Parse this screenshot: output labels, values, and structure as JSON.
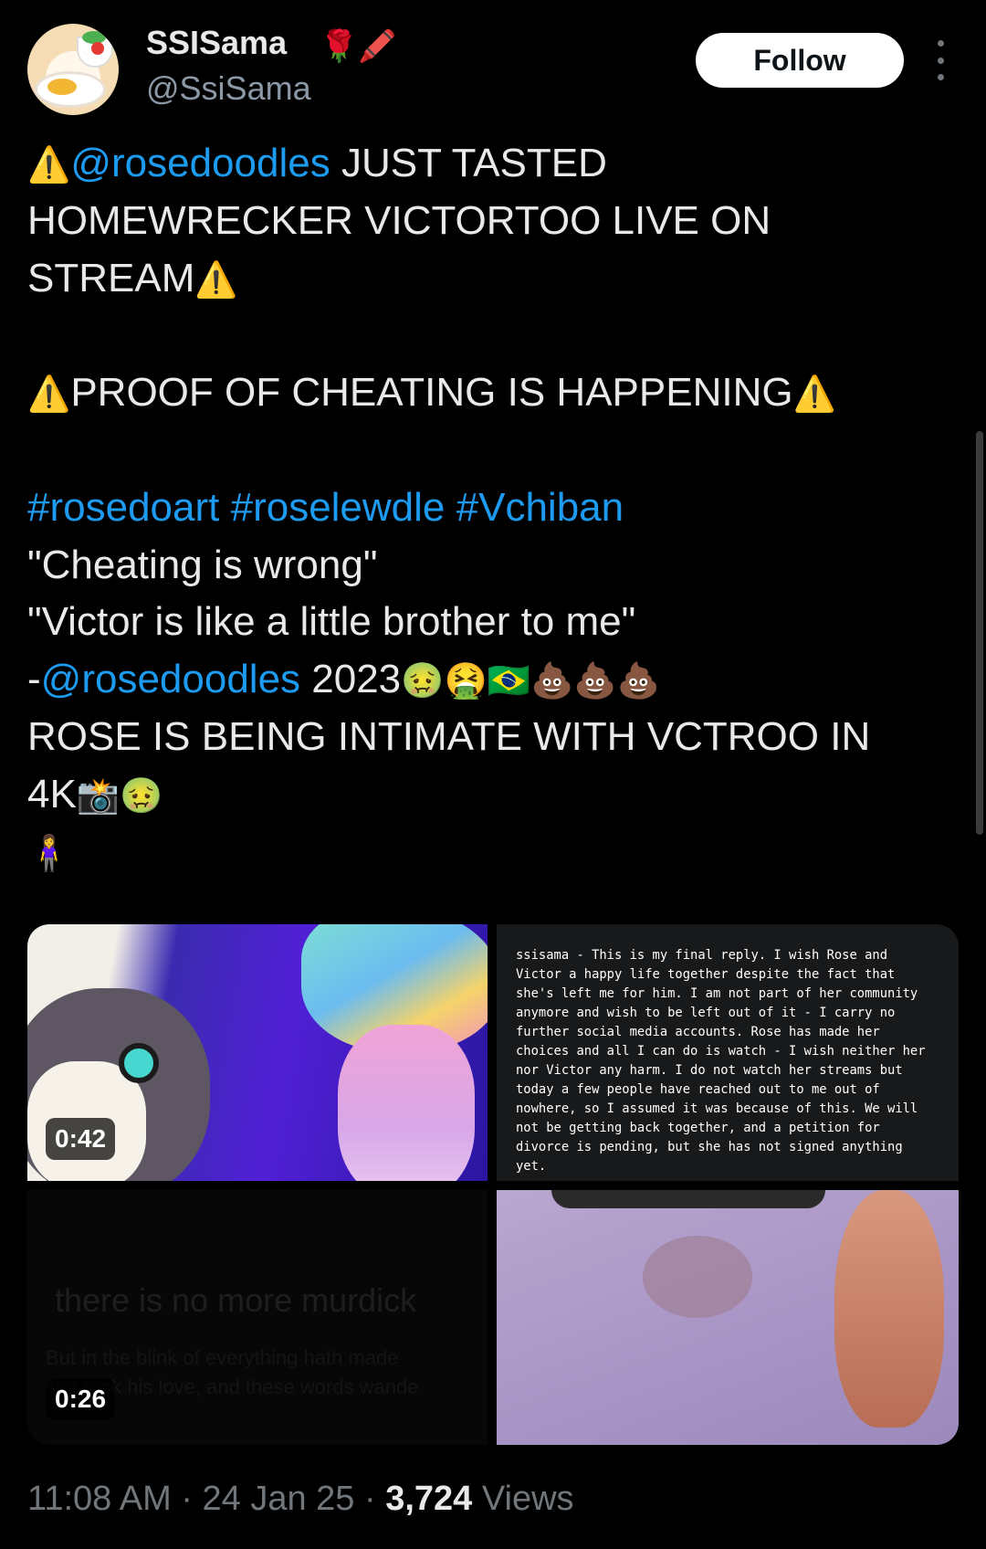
{
  "user": {
    "display_name": "SSISama",
    "name_emojis": "🌹🖍️",
    "handle": "@SsiSama",
    "follow_label": "Follow"
  },
  "tweet": {
    "line1_prefix": "⚠️",
    "line1_mention": "@rosedoodles",
    "line1_text": " JUST TASTED",
    "line2": "HOMEWRECKER VICTORTOO LIVE ON",
    "line3_text": "STREAM",
    "line3_emoji": "⚠️",
    "line4_prefix": "⚠️",
    "line4_text": "PROOF OF CHEATING IS HAPPENING",
    "line4_suffix": "⚠️",
    "hashtags": [
      "#rosedoart",
      "#roselewdle",
      "#Vchiban"
    ],
    "quote1": "\"Cheating is wrong\"",
    "quote2": "\"Victor is like a little brother to me\"",
    "sig_dash": "-",
    "sig_mention": "@rosedoodles",
    "sig_year": " 2023",
    "sig_emojis": "🤢🤮🇧🇷💩💩💩",
    "line_rose": "ROSE IS BEING INTIMATE WITH VCTROO IN",
    "line_4k": "4K",
    "line_4k_emojis": "📸🤢",
    "last_emoji": "🧍‍♀️"
  },
  "media": [
    {
      "type": "video",
      "duration": "0:42"
    },
    {
      "type": "image",
      "note": "ssisama - This is my final reply. I wish Rose and Victor a happy life together despite the fact that she's left me for him. I am not part of her community anymore and wish to be left out of it - I carry no further social media accounts. Rose has made her choices and all I can do is watch - I wish neither her nor Victor any harm. I do not watch her streams but today a few people have reached out to me out of nowhere, so I assumed it was because of this. We will not be getting back together, and a petition for divorce is pending, but she has not signed anything yet."
    },
    {
      "type": "video",
      "duration": "0:26",
      "faded_title": "there is no more murdick",
      "faded_sub1": "But in the blink of everything hath made",
      "faded_sub2": "she took his love, and these words wande"
    },
    {
      "type": "image"
    }
  ],
  "meta": {
    "time": "11:08 AM",
    "sep1": " · ",
    "date": "24 Jan 25",
    "sep2": " · ",
    "views_count": "3,724",
    "views_label": " Views"
  }
}
